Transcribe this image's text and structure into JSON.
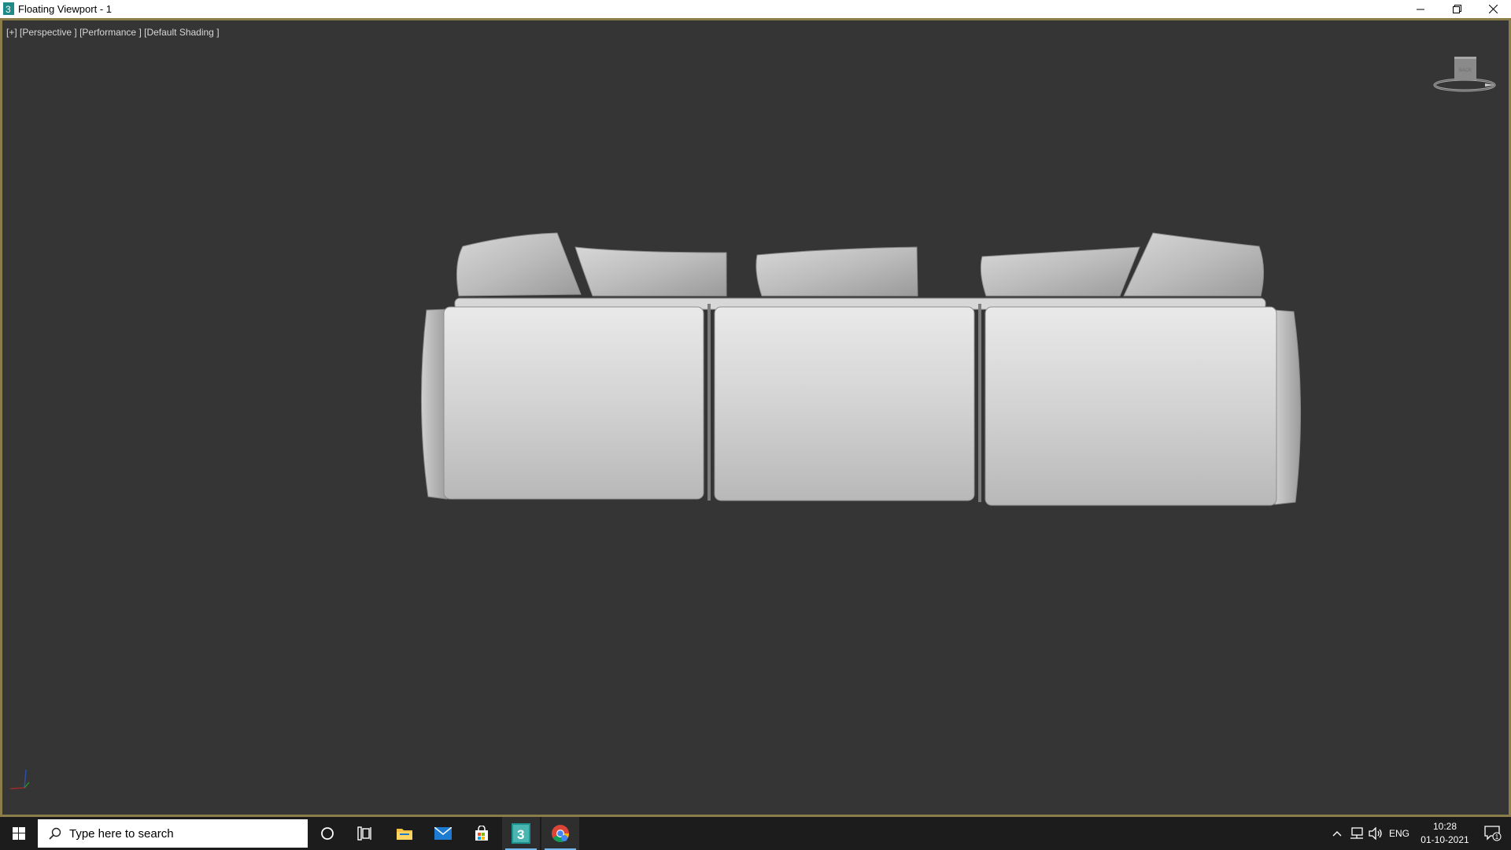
{
  "window": {
    "title": "Floating Viewport - 1",
    "minimize_icon": "minimize-icon",
    "restore_icon": "restore-icon",
    "close_icon": "close-icon"
  },
  "viewport": {
    "label_plus": "[+]",
    "label_view": "[Perspective ]",
    "label_mode": "[Performance ]",
    "label_shading": "[Default Shading ]",
    "viewcube_face": "BACK",
    "border_color": "#8b7d4a",
    "background_color": "#353535"
  },
  "taskbar": {
    "search_placeholder": "Type here to search",
    "apps": [
      {
        "name": "cortana-icon"
      },
      {
        "name": "task-view-icon"
      },
      {
        "name": "file-explorer-icon"
      },
      {
        "name": "mail-icon"
      },
      {
        "name": "store-icon"
      },
      {
        "name": "3ds-max-icon",
        "label": "3"
      },
      {
        "name": "chrome-icon"
      }
    ],
    "language": "ENG",
    "time": "10:28",
    "date": "01-10-2021",
    "notification_count": "1"
  }
}
